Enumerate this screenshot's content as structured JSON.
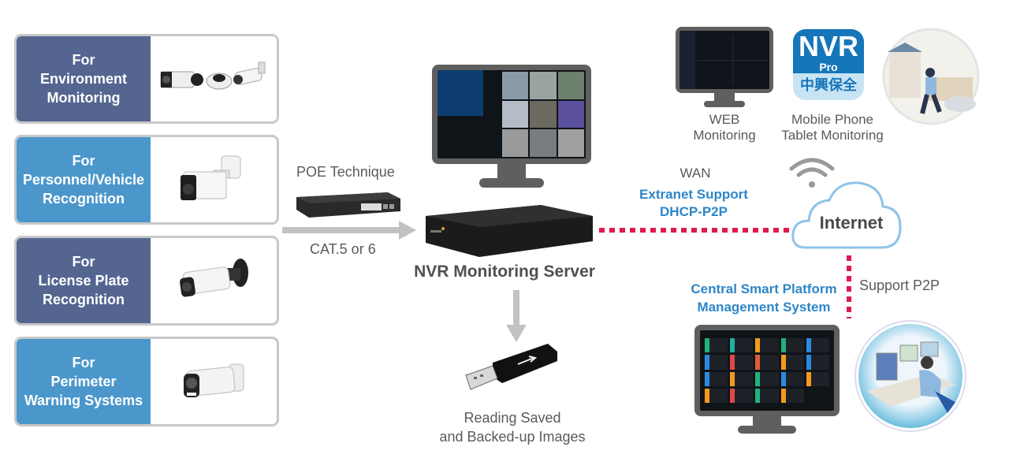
{
  "panels": [
    {
      "line1": "For",
      "line2": "Environment",
      "line3": "Monitoring",
      "camera": "multi-camera-set"
    },
    {
      "line1": "For",
      "line2": "Personnel/Vehicle",
      "line3": "Recognition",
      "camera": "bullet-camera"
    },
    {
      "line1": "For",
      "line2": "License Plate",
      "line3": "Recognition",
      "camera": "bullet-camera-bracket"
    },
    {
      "line1": "For",
      "line2": "Perimeter",
      "line3": "Warning Systems",
      "camera": "bullet-camera-light"
    }
  ],
  "poe": {
    "title": "POE Technique",
    "cable": "CAT.5 or 6"
  },
  "nvr": {
    "label": "NVR Monitoring Server"
  },
  "usb": {
    "line1": "Reading Saved",
    "line2": "and Backed-up Images"
  },
  "wan": {
    "title": "WAN",
    "line1": "Extranet Support",
    "line2": "DHCP-P2P"
  },
  "internet": {
    "label": "Internet"
  },
  "web": {
    "line1": "WEB",
    "line2": "Monitoring"
  },
  "mobile": {
    "line1": "Mobile Phone",
    "line2": "Tablet Monitoring",
    "app_big": "NVR",
    "app_small": "Pro",
    "app_cn": "中興保全"
  },
  "central": {
    "line1": "Central Smart Platform",
    "line2": "Management System"
  },
  "p2p": {
    "label": "Support P2P"
  },
  "colors": {
    "panel_dark": "#546590",
    "panel_light": "#4b97cc",
    "accent_blue": "#2e86c8",
    "link_red": "#e0194f",
    "cloud_stroke": "#8ec3e8"
  }
}
